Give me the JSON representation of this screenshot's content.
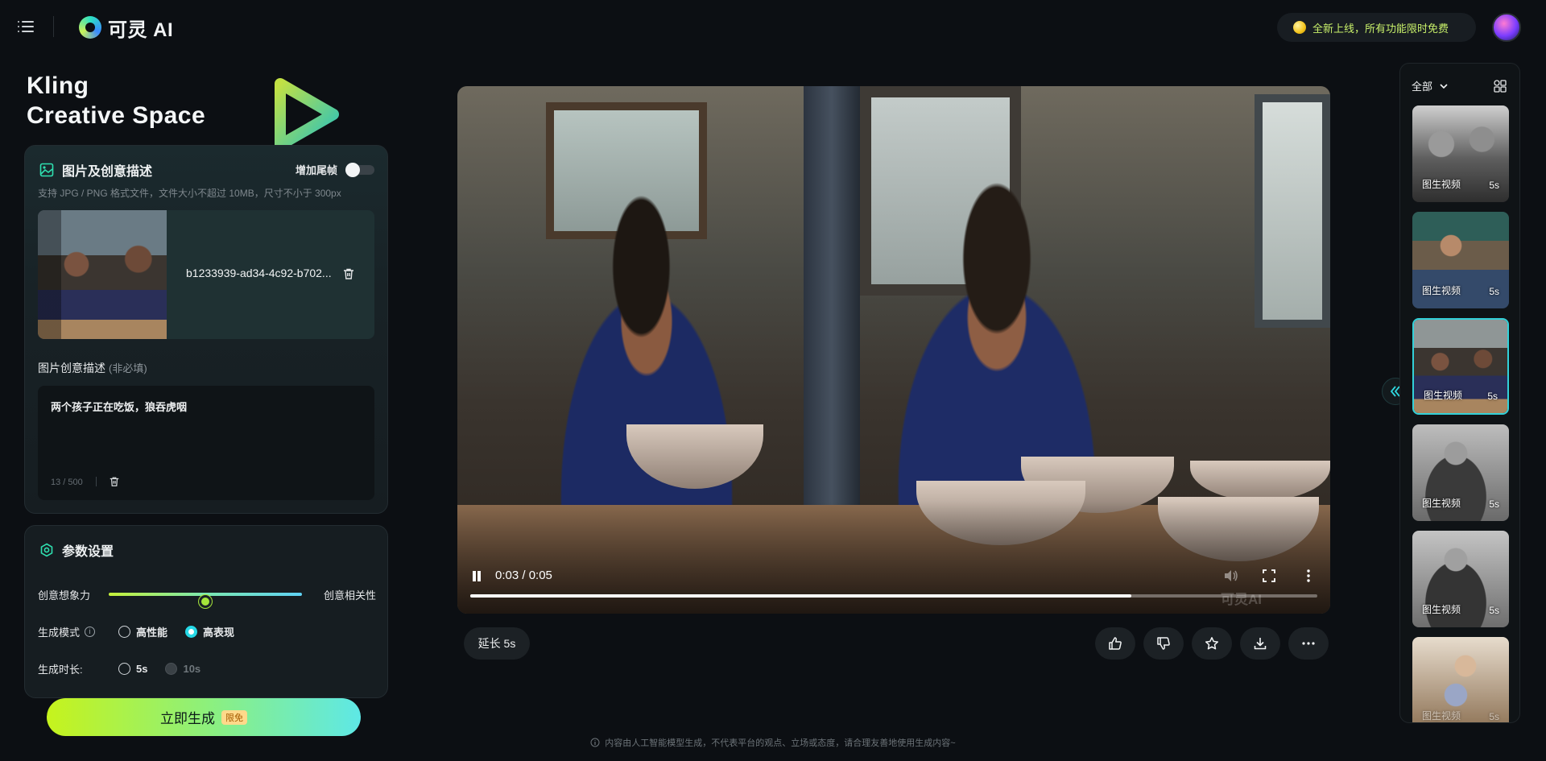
{
  "app": {
    "logo_text": "可灵 AI"
  },
  "header": {
    "promo_text": "全新上线，所有功能限时免费"
  },
  "hero": {
    "title_line1": "Kling",
    "title_line2": "Creative Space"
  },
  "upload_card": {
    "title": "图片及创意描述",
    "end_frame_label": "增加尾帧",
    "end_frame_enabled": false,
    "hint": "支持 JPG / PNG 格式文件，文件大小不超过 10MB，尺寸不小于 300px",
    "filename": "b1233939-ad34-4c92-b702...",
    "description_label": "图片创意描述",
    "description_optional": "(非必填)",
    "description_value": "两个孩子正在吃饭，狼吞虎咽",
    "char_count": "13 / 500"
  },
  "params_card": {
    "title": "参数设置",
    "slider_left_label": "创意想象力",
    "slider_right_label": "创意相关性",
    "slider_value": 0.5,
    "mode_label": "生成模式",
    "modes": [
      {
        "label": "高性能",
        "selected": false
      },
      {
        "label": "高表现",
        "selected": true
      }
    ],
    "duration_label": "生成时长:",
    "durations": [
      {
        "label": "5s",
        "selected": false,
        "disabled": false
      },
      {
        "label": "10s",
        "selected": false,
        "disabled": true
      }
    ]
  },
  "generate": {
    "label": "立即生成",
    "badge": "限免"
  },
  "player": {
    "time": "0:03 / 0:05",
    "progress": 0.78,
    "watermark": "可灵AI"
  },
  "actions": {
    "extend_label": "延长 5s"
  },
  "footer": {
    "note": "内容由人工智能模型生成，不代表平台的观点、立场或态度，请合理友善地使用生成内容~"
  },
  "history": {
    "filter_label": "全部",
    "items": [
      {
        "label": "图生视频",
        "duration": "5s",
        "selected": false
      },
      {
        "label": "图生视频",
        "duration": "5s",
        "selected": false
      },
      {
        "label": "图生视频",
        "duration": "5s",
        "selected": true
      },
      {
        "label": "图生视频",
        "duration": "5s",
        "selected": false
      },
      {
        "label": "图生视频",
        "duration": "5s",
        "selected": false
      },
      {
        "label": "图生视频",
        "duration": "5s",
        "selected": false
      }
    ]
  },
  "icons": {
    "menu": "menu-icon",
    "image": "image-icon",
    "delete": "trash-icon",
    "settings": "settings-icon",
    "info": "info-icon",
    "pause": "pause-icon",
    "volume": "volume-icon",
    "fullscreen": "fullscreen-icon",
    "more": "more-icon",
    "like": "thumbs-up-icon",
    "dislike": "thumbs-down-icon",
    "favorite": "star-icon",
    "download": "download-icon",
    "grid": "grid-icon",
    "expand": "double-chevron-left-icon"
  },
  "colors": {
    "accent": "#25d8e6",
    "promo": "#c8f06a",
    "background": "#0c0f13"
  }
}
